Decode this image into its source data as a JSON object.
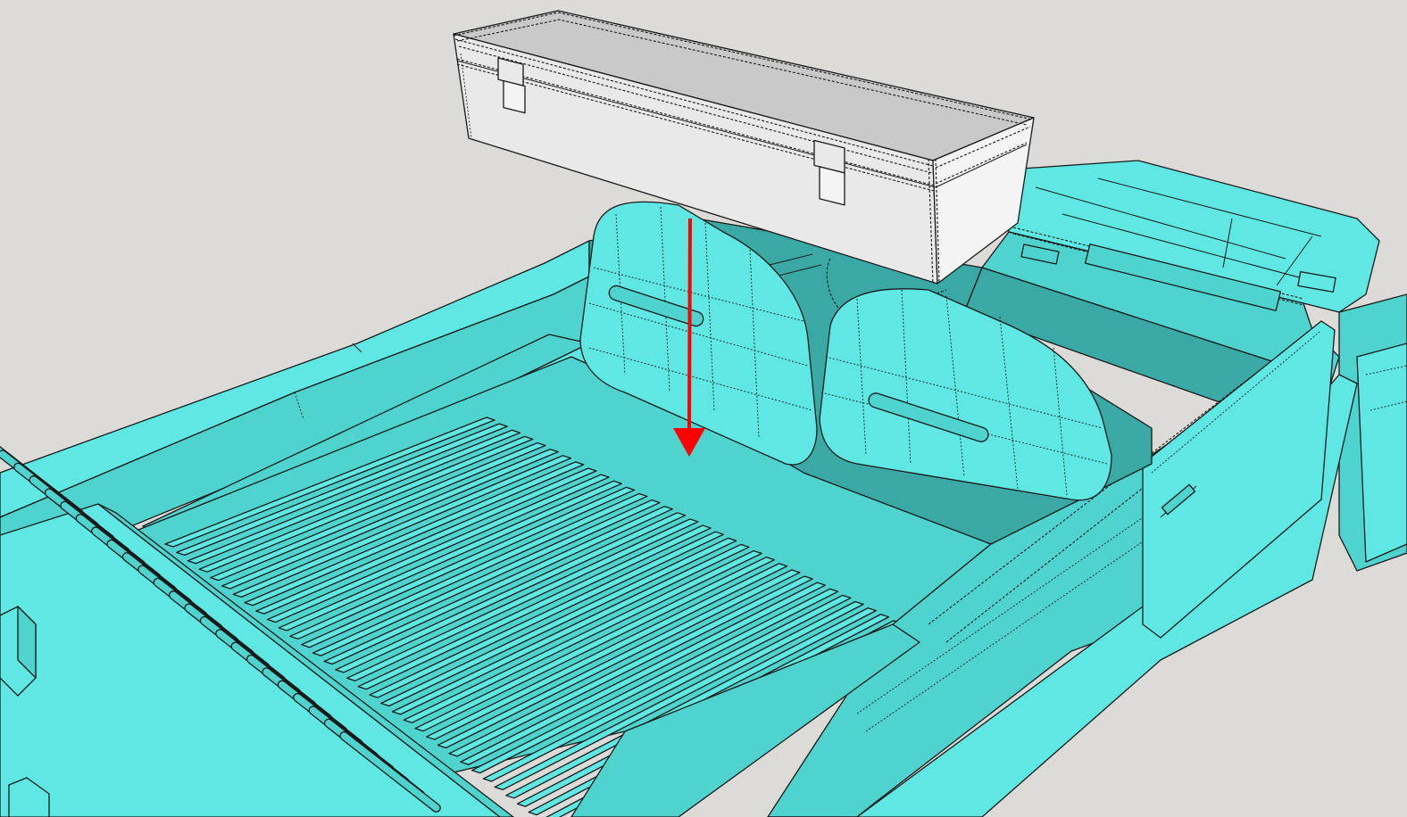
{
  "viewport": {
    "background": "#dcdbd7"
  },
  "colors": {
    "model_light": "#5fe8e3",
    "model_mid": "#4fd3cf",
    "model_dark": "#3aa9a6",
    "model_shadow": "#2f8f8c",
    "box_top": "#c9c9c9",
    "box_front": "#e9e9e9",
    "box_side": "#f4f4f4",
    "edge": "#1a1a1a",
    "move_axis": "#ff0000"
  },
  "scene": {
    "selected_component": "storage-box",
    "move_direction": "down",
    "rib_count": 34,
    "slot_count": 24
  }
}
